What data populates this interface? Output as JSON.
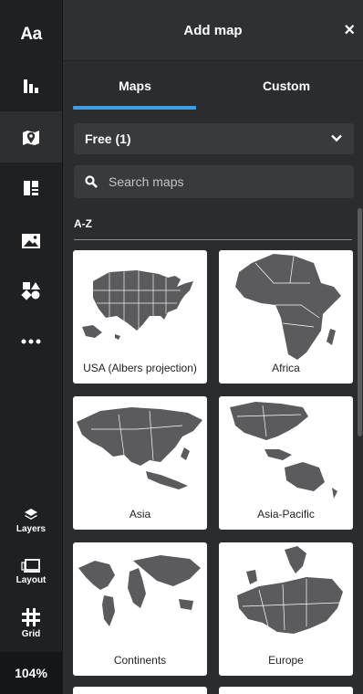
{
  "rail": {
    "text_label": "Aa",
    "items": [
      "text-icon",
      "chart-icon",
      "map-icon",
      "layout-block-icon",
      "image-icon",
      "shapes-icon",
      "more-icon"
    ],
    "layers_label": "Layers",
    "layout_label": "Layout",
    "grid_label": "Grid",
    "zoom": "104%"
  },
  "panel": {
    "title": "Add map",
    "close": "×",
    "tabs": [
      {
        "label": "Maps",
        "active": true
      },
      {
        "label": "Custom",
        "active": false
      }
    ],
    "filter_value": "Free (1)",
    "search_placeholder": "Search maps",
    "section_label": "A-Z",
    "maps": [
      {
        "name": "USA (Albers projection)"
      },
      {
        "name": "Africa"
      },
      {
        "name": "Asia"
      },
      {
        "name": "Asia-Pacific"
      },
      {
        "name": "Continents"
      },
      {
        "name": "Europe"
      }
    ]
  },
  "colors": {
    "accent": "#3f9ee3",
    "rail": "#1f2022",
    "panel": "#2b2c2e",
    "map_fill": "#5b5b5d"
  }
}
